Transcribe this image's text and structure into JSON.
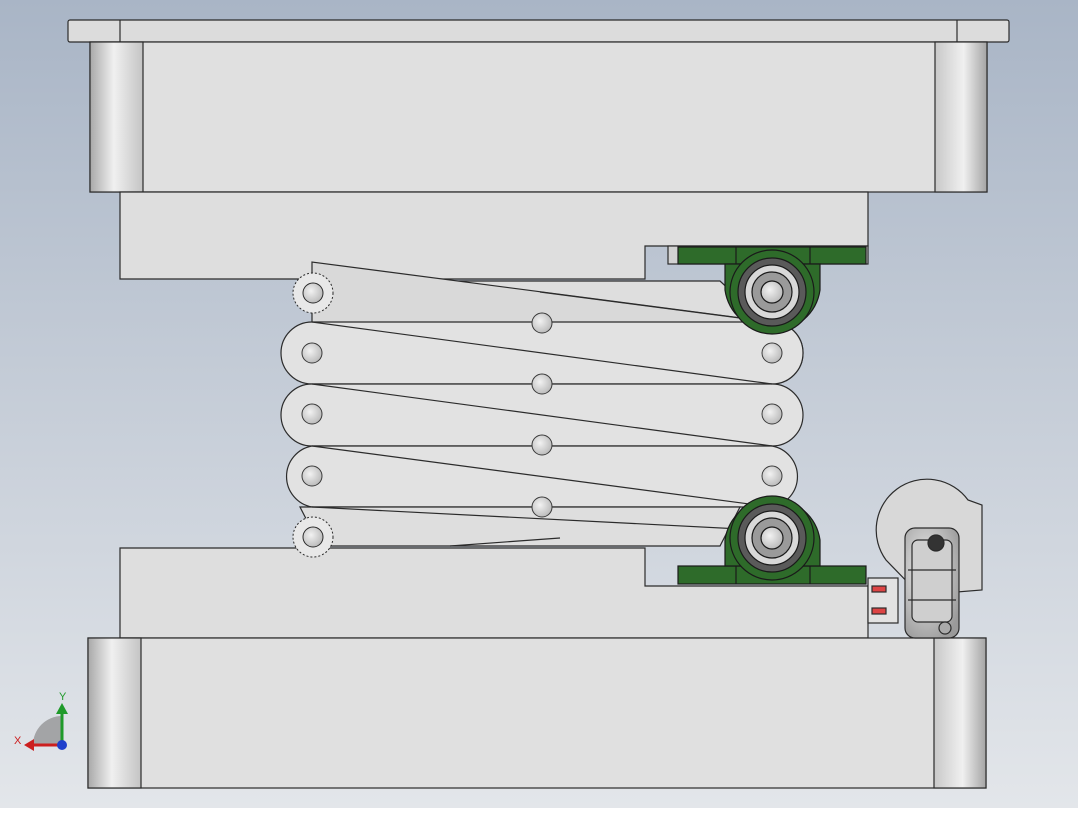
{
  "viewport": {
    "background_top": "#a9b5c6",
    "background_bottom": "#e3e6ea"
  },
  "model": {
    "plate_color": "#e0e0e0",
    "edge_color": "#2b2b2b",
    "bearing_block_color": "#2e6b2a",
    "bearing_block_dark": "#1f4d1c",
    "bearing_ring_color": "#5a5a5a",
    "pin_color": "#cfcfcf"
  },
  "triad": {
    "x_label": "X",
    "y_label": "Y",
    "x_color": "#cc1f1f",
    "y_color": "#1f9a2a",
    "z_color": "#1f3fcc"
  }
}
